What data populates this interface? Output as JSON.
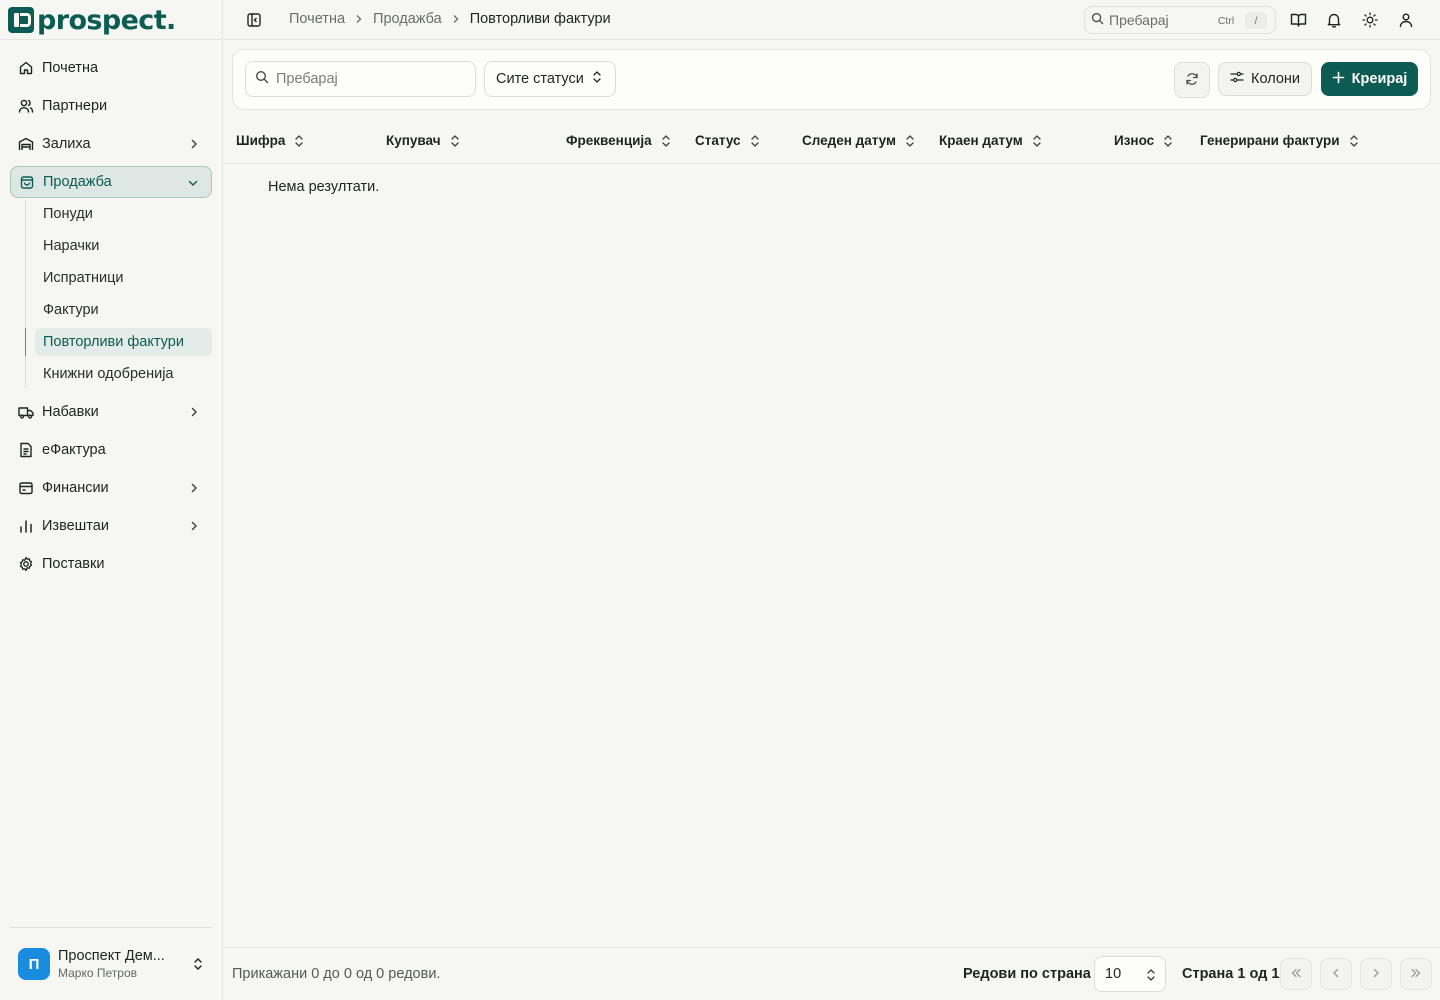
{
  "brand": {
    "name": "prospect."
  },
  "sidebar": {
    "items": [
      {
        "label": "Почетна"
      },
      {
        "label": "Партнери"
      },
      {
        "label": "Залиха"
      },
      {
        "label": "Продажба"
      },
      {
        "label": "Набавки"
      },
      {
        "label": "еФактура"
      },
      {
        "label": "Финансии"
      },
      {
        "label": "Извештаи"
      },
      {
        "label": "Поставки"
      }
    ],
    "sales_sub": [
      {
        "label": "Понуди"
      },
      {
        "label": "Нарачки"
      },
      {
        "label": "Испратници"
      },
      {
        "label": "Фактури"
      },
      {
        "label": "Повторливи фактури"
      },
      {
        "label": "Книжни одобренија"
      }
    ],
    "org": {
      "avatar": "П",
      "name": "Проспект Дем...",
      "user": "Марко Петров"
    }
  },
  "header": {
    "breadcrumbs": [
      "Почетна",
      "Продажба",
      "Повторливи фактури"
    ],
    "search_placeholder": "Пребарај",
    "kbd_ctrl": "Ctrl",
    "kbd_slash": "/"
  },
  "filters": {
    "search_placeholder": "Пребарај",
    "status_value": "Сите статуси",
    "columns_label": "Колони",
    "create_label": "Креирај"
  },
  "table": {
    "columns": [
      "Шифра",
      "Купувач",
      "Фреквенција",
      "Статус",
      "Следен датум",
      "Краен датум",
      "Износ",
      "Генерирани фактури"
    ],
    "empty": "Нема резултати."
  },
  "footer": {
    "summary": "Прикажани 0 до 0 од 0 редови.",
    "rows_label": "Редови по страна",
    "rows_value": "10",
    "page_label": "Страна 1 од 1"
  },
  "colors": {
    "accent": "#0c5c54",
    "avatar": "#1a8ce0"
  }
}
